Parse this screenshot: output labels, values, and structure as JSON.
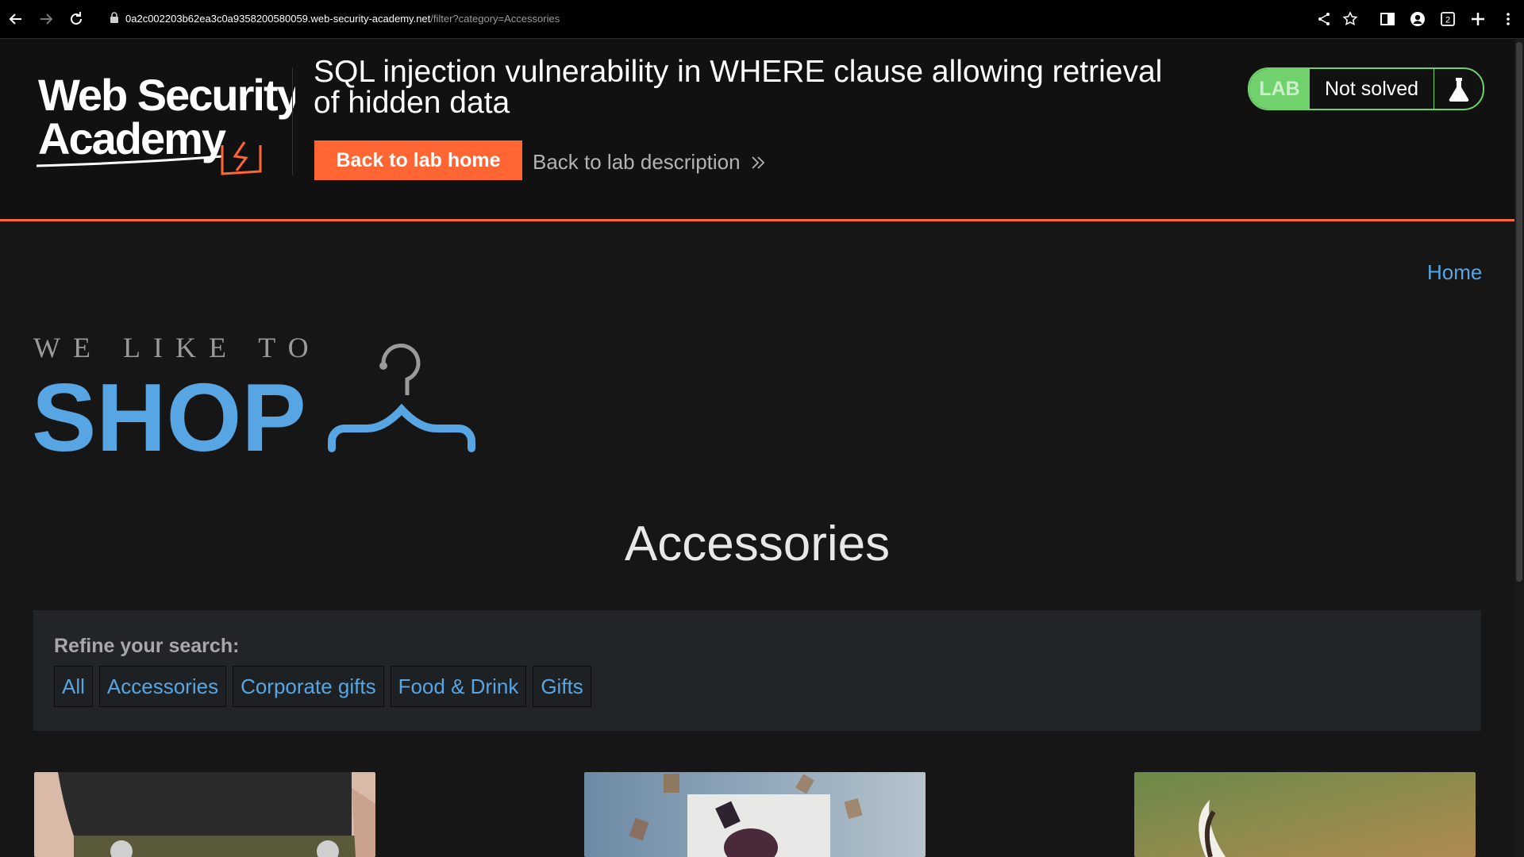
{
  "browser": {
    "url_host": "0a2c002203b62ea3c0a9358200580059.web-security-academy.net",
    "url_path": "/filter?category=Accessories",
    "icons": [
      "back-icon",
      "forward-icon",
      "reload-icon",
      "lock-icon",
      "share-icon",
      "star-icon",
      "sidebar-icon",
      "profile-icon",
      "tab-count-icon",
      "new-tab-icon",
      "menu-icon"
    ],
    "tab_count": "2"
  },
  "lab": {
    "logo_line1": "Web Security",
    "logo_line2": "Academy",
    "title": "SQL injection vulnerability in WHERE clause allowing retrieval of hidden data",
    "back_home": "Back to lab home",
    "back_description": "Back to lab description",
    "badge": "LAB",
    "status": "Not solved",
    "accent_color": "#ff6633",
    "status_color": "#70d16d"
  },
  "shop": {
    "home_link": "Home",
    "logo_small": "WE LIKE TO",
    "logo_big": "SHOP",
    "heading": "Accessories",
    "refine_label": "Refine your search:",
    "filters": [
      "All",
      "Accessories",
      "Corporate gifts",
      "Food & Drink",
      "Gifts"
    ],
    "link_color": "#57a5e2"
  }
}
